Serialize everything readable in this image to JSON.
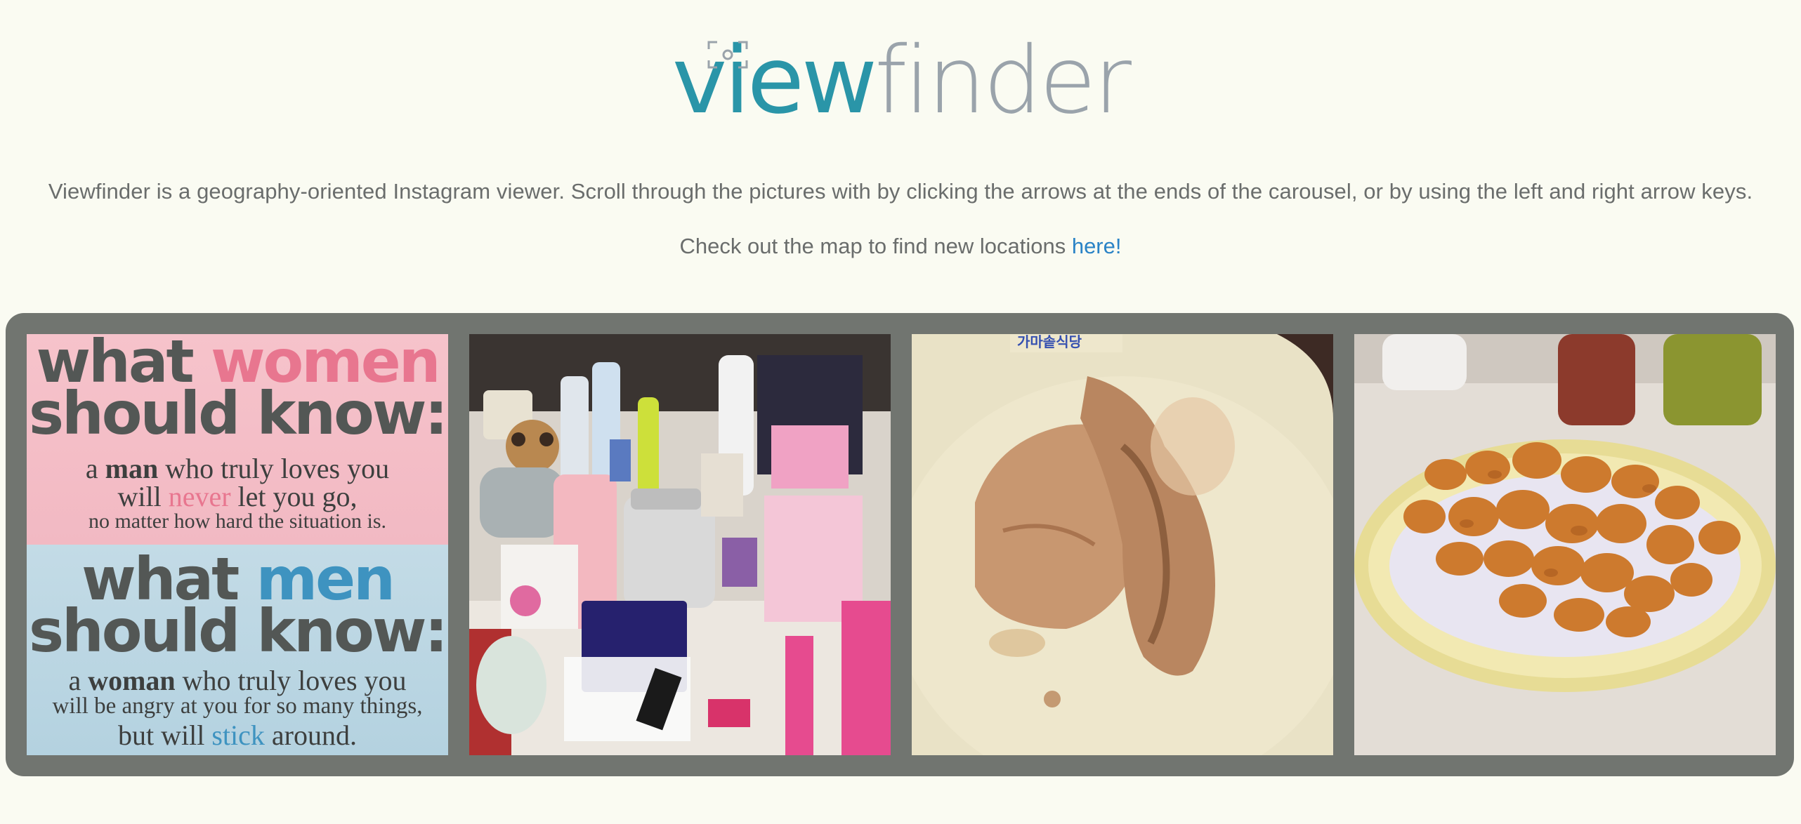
{
  "logo": {
    "part1": "view",
    "part2": "finder",
    "colors": {
      "view": "#2a95a8",
      "finder": "#9aa3ab"
    }
  },
  "intro": {
    "description": "Viewfinder is a geography-oriented Instagram viewer. Scroll through the pictures with by clicking the arrows at the ends of the carousel, or by using the left and right arrow keys.",
    "map_prefix": "Check out the map to find new locations ",
    "map_link": "here!"
  },
  "carousel": {
    "photos": [
      {
        "poster": {
          "h1a": "what ",
          "h1b": "women",
          "h2": "should know:",
          "l1a": "a ",
          "l1b": "man",
          "l1c": " who truly loves you",
          "l2a": "will ",
          "l2b": "never",
          "l2c": " let you go,",
          "l3": "no matter how hard the situation is.",
          "h3a": "what ",
          "h3b": "men",
          "h4": "should know:",
          "l4a": "a ",
          "l4b": "woman",
          "l4c": " who truly loves you",
          "l5": "will be angry at you for so many things,",
          "l6a": "but will ",
          "l6b": "stick",
          "l6c": " around."
        }
      },
      {
        "subject": "cosmetics"
      },
      {
        "subject": "braised-meat"
      },
      {
        "subject": "fried-chicken"
      }
    ]
  }
}
